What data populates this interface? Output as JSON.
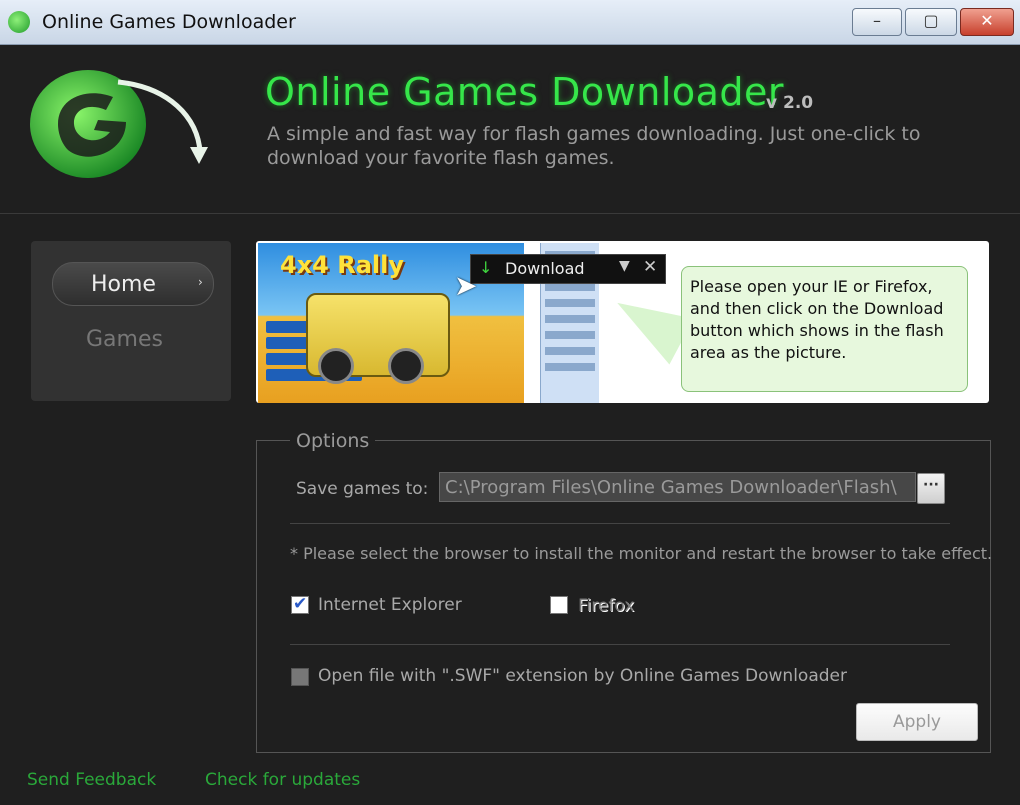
{
  "window": {
    "title": "Online Games Downloader",
    "controls": {
      "minimize": "–",
      "maximize": "▢",
      "close": "✕"
    }
  },
  "header": {
    "app_name": "Online Games Downloader",
    "version": "v 2.0",
    "tagline": "A simple and fast way for flash games downloading. Just one-click to download your favorite flash games.",
    "logo_icon": "g-arrow-logo-icon"
  },
  "sidebar": {
    "items": [
      {
        "label": "Home",
        "active": true,
        "arrow": "›"
      },
      {
        "label": "Games",
        "active": false
      }
    ]
  },
  "banner": {
    "game_title": "4x4 Rally",
    "download_bar": {
      "label": "Download",
      "arrow_icon": "↓",
      "chevron": "▼",
      "close": "✕"
    },
    "tooltip": "Please open your IE or Firefox, and then click on the Download button which shows in the flash area as the picture."
  },
  "options": {
    "legend": "Options",
    "save_label": "Save games to:",
    "save_path": "C:\\Program Files\\Online Games Downloader\\Flash\\",
    "browse_label": "···",
    "note": "* Please select the browser to install the monitor and restart the browser to take effect.",
    "browsers": [
      {
        "label": "Internet Explorer",
        "checked": true
      },
      {
        "label": "Firefox",
        "checked": false
      }
    ],
    "swf_label": "Open file with \".SWF\" extension by Online Games Downloader",
    "swf_checked": false,
    "apply_label": "Apply"
  },
  "footer": {
    "feedback": "Send Feedback",
    "updates": "Check for updates"
  },
  "colors": {
    "accent_green": "#36e64a",
    "link_green": "#2aa83a",
    "background": "#1f1f1f"
  }
}
